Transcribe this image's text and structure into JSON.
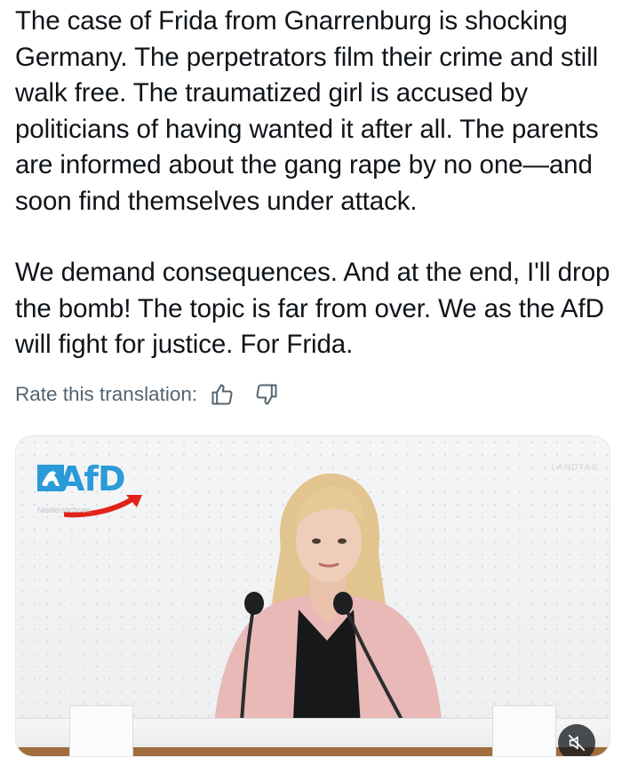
{
  "post": {
    "paragraphs": [
      "The case of Frida from Gnarrenburg is shocking Germany. The perpetrators film their crime and still walk free. The traumatized girl is accused by politicians of having wanted it after all. The parents are informed about the gang rape by no one—and soon find themselves under attack.",
      "We demand consequences. And at the end, I'll drop the bomb! The topic is far from over. We as the AfD will fight for justice. For Frida."
    ]
  },
  "translation": {
    "rate_label": "Rate this translation:",
    "thumbs_up_icon": "thumbs-up-icon",
    "thumbs_down_icon": "thumbs-down-icon"
  },
  "media": {
    "logo_text": "AfD",
    "logo_subtext": "Niedersachsen",
    "watermark": "LANDTAG",
    "mute_icon": "speaker-muted-icon",
    "colors": {
      "logo_blue": "#2b9ad8",
      "logo_arrow_red": "#e2231a",
      "jacket_pink": "#e8b9b7"
    }
  },
  "colors": {
    "text": "#0f1419",
    "secondary_text": "#536471"
  }
}
